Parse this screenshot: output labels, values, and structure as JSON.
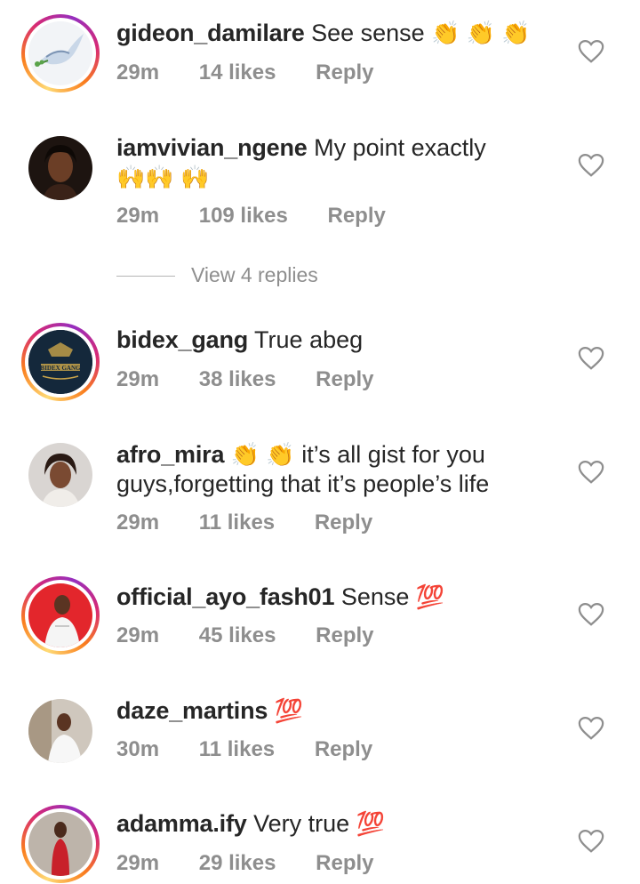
{
  "comments": [
    {
      "username": "gideon_damilare",
      "text": "See sense",
      "emoji": "👏 👏 👏",
      "time": "29m",
      "likes": "14 likes",
      "reply": "Reply"
    },
    {
      "username": "iamvivian_ngene",
      "text": "My point exactly",
      "emoji": "🙌🙌 🙌",
      "time": "29m",
      "likes": "109 likes",
      "reply": "Reply"
    },
    {
      "username": "bidex_gang",
      "text": "True abeg",
      "emoji": "",
      "time": "29m",
      "likes": "38 likes",
      "reply": "Reply",
      "avatar_text": "BIDEX GANG"
    },
    {
      "username": "afro_mira",
      "text": "it’s all gist for you guys,forgetting that it’s people’s life",
      "emoji": "👏 👏",
      "time": "29m",
      "likes": "11 likes",
      "reply": "Reply"
    },
    {
      "username": "official_ayo_fash01",
      "text": "Sense",
      "emoji": "💯",
      "time": "29m",
      "likes": "45 likes",
      "reply": "Reply"
    },
    {
      "username": "daze_martins",
      "text": "",
      "emoji": "💯",
      "time": "30m",
      "likes": "11 likes",
      "reply": "Reply"
    },
    {
      "username": "adamma.ify",
      "text": "Very true",
      "emoji": "💯",
      "time": "29m",
      "likes": "29 likes",
      "reply": "Reply"
    }
  ],
  "view_replies": "View 4 replies",
  "colors": {
    "muted": "#8e8e8e",
    "text": "#262626",
    "heart": "#8e8e8e"
  }
}
